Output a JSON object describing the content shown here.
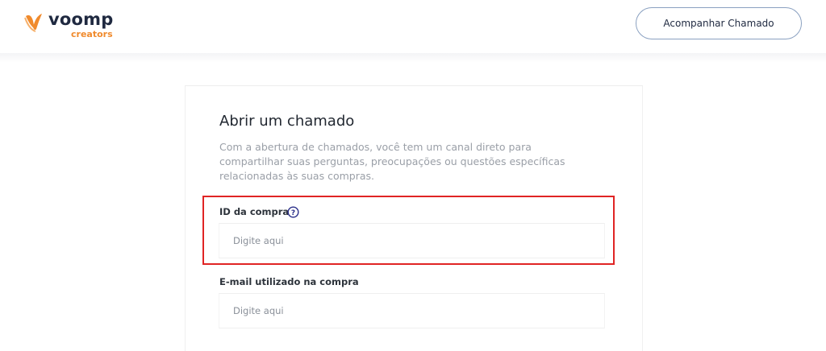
{
  "header": {
    "logo_text": "voomp",
    "logo_subtext": "creators",
    "track_button_label": "Acompanhar Chamado"
  },
  "form": {
    "title": "Abrir um chamado",
    "description": "Com a abertura de chamados, você tem um canal direto para compartilhar suas perguntas, preocupações ou questões específicas relacionadas às suas compras.",
    "fields": [
      {
        "label": "ID da compra",
        "placeholder": "Digite aqui",
        "value": "",
        "help_icon": "question-circle-icon"
      },
      {
        "label": "E-mail utilizado na compra",
        "placeholder": "Digite aqui",
        "value": ""
      }
    ]
  },
  "colors": {
    "brand_orange": "#f08a2c",
    "brand_navy": "#1f2940",
    "highlight_red": "#e02424",
    "help_icon": "#2b2f8a"
  }
}
